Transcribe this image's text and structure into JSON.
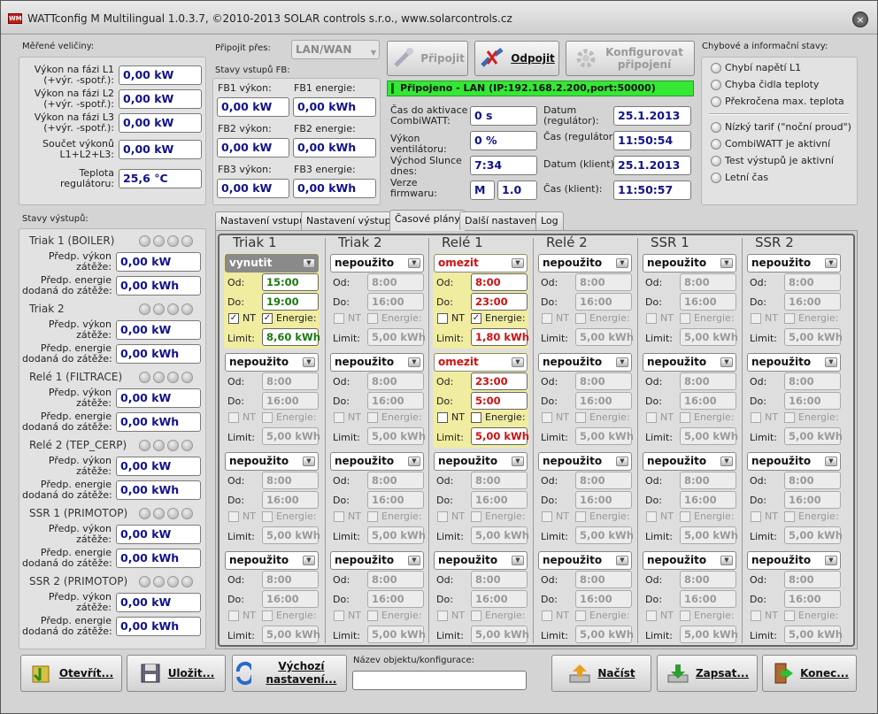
{
  "title": "WATTconfig M  Multilingual 1.0.3.7, ©2010-2013 SOLAR controls s.r.o., www.solarcontrols.cz",
  "logo_text": "WM",
  "close_glyph": "×",
  "measured": {
    "title": "Měřené veličiny:",
    "rows": [
      {
        "label": "Výkon na fázi L1\n(+výr. -spotř.):",
        "value": "0,00 kW"
      },
      {
        "label": "Výkon na fázi L2\n(+výr. -spotř.):",
        "value": "0,00 kW"
      },
      {
        "label": "Výkon na fázi L3\n(+výr. -spotř.):",
        "value": "0,00 kW"
      },
      {
        "label": "Součet výkonů\nL1+L2+L3:",
        "value": "0,00 kW"
      },
      {
        "label": "Teplota\nregulátoru:",
        "value": "25,6 °C"
      }
    ]
  },
  "connect": {
    "via_label": "Připojit přes:",
    "via_value": "LAN/WAN",
    "connect_btn": "Připojit",
    "disconnect_btn": "Odpojit",
    "config_btn": "Konfigurovat připojení",
    "status": "Připojeno - LAN (IP:192.168.2.200,port:50000)"
  },
  "fb": {
    "title": "Stavy vstupů FB:",
    "items": [
      {
        "power_label": "FB1 výkon:",
        "power": "0,00 kW",
        "energy_label": "FB1 energie:",
        "energy": "0,00 kWh"
      },
      {
        "power_label": "FB2 výkon:",
        "power": "0,00 kW",
        "energy_label": "FB2 energie:",
        "energy": "0,00 kWh"
      },
      {
        "power_label": "FB3 výkon:",
        "power": "0,00 kW",
        "energy_label": "FB3 energie:",
        "energy": "0,00 kWh"
      }
    ]
  },
  "info": {
    "activation_label": "Čas do aktivace\nCombiWATT:",
    "activation": "0 s",
    "fan_label": "Výkon ventilátoru:",
    "fan": "0 %",
    "sunrise_label": "Východ Slunce\ndnes:",
    "sunrise": "7:34",
    "fw_label": "Verze\nfirmwaru:",
    "fw_a": "M",
    "fw_b": "1.0",
    "date_reg_label": "Datum\n(regulátor):",
    "date_reg": "25.1.2013",
    "time_reg_label": "Čas (regulátor):",
    "time_reg": "11:50:54",
    "date_cli_label": "Datum (klient):",
    "date_cli": "25.1.2013",
    "time_cli_label": "Čas (klient):",
    "time_cli": "11:50:57"
  },
  "errors": {
    "title": "Chybové a informační stavy:",
    "items": [
      "Chybí napětí L1",
      "Chyba čidla teploty",
      "Překročena max. teplota",
      "Nízký tarif (\"noční proud\")",
      "CombiWATT je aktivní",
      "Test výstupů je aktivní",
      "Letní čas"
    ]
  },
  "outputs": {
    "title": "Stavy výstupů:",
    "power_label": "Předp. výkon\nzátěže:",
    "energy_label": "Předp. energie\ndodaná do zátěže:",
    "items": [
      {
        "name": "Triak 1 (BOILER)",
        "power": "0,00 kW",
        "energy": "0,00 kWh"
      },
      {
        "name": "Triak 2",
        "power": "0,00 kW",
        "energy": "0,00 kWh"
      },
      {
        "name": "Relé 1 (FILTRACE)",
        "power": "0,00 kW",
        "energy": "0,00 kWh"
      },
      {
        "name": "Relé 2 (TEP_CERP)",
        "power": "0,00 kW",
        "energy": "0,00 kWh"
      },
      {
        "name": "SSR 1 (PRIMOTOP)",
        "power": "0,00 kW",
        "energy": "0,00 kWh"
      },
      {
        "name": "SSR 2 (PRIMOTOP)",
        "power": "0,00 kW",
        "energy": "0,00 kWh"
      }
    ]
  },
  "tabs": [
    "Nastavení vstupů",
    "Nastavení výstupů",
    "Časové plány",
    "Další nastavení",
    "Log"
  ],
  "active_tab": 2,
  "schedule": {
    "from_label": "Od:",
    "to_label": "Do:",
    "nt_label": "NT",
    "energy_label": "Energie:",
    "limit_label": "Limit:",
    "columns": [
      {
        "name": "Triak 1",
        "blocks": [
          {
            "mode": "vynutit",
            "style": "gray",
            "active": true,
            "from": "15:00",
            "to": "19:00",
            "nt": true,
            "energy": true,
            "limit": "8,60 kWh",
            "tone": "ok"
          },
          {
            "mode": "nepoužito",
            "from": "8:00",
            "to": "16:00",
            "limit": "5,00 kWh"
          },
          {
            "mode": "nepoužito",
            "from": "8:00",
            "to": "16:00",
            "limit": "5,00 kWh"
          },
          {
            "mode": "nepoužito",
            "from": "8:00",
            "to": "16:00",
            "limit": "5,00 kWh"
          }
        ]
      },
      {
        "name": "Triak 2",
        "blocks": [
          {
            "mode": "nepoužito",
            "from": "8:00",
            "to": "16:00",
            "limit": "5,00 kWh"
          },
          {
            "mode": "nepoužito",
            "from": "8:00",
            "to": "16:00",
            "limit": "5,00 kWh"
          },
          {
            "mode": "nepoužito",
            "from": "8:00",
            "to": "16:00",
            "limit": "5,00 kWh"
          },
          {
            "mode": "nepoužito",
            "from": "8:00",
            "to": "16:00",
            "limit": "5,00 kWh"
          }
        ]
      },
      {
        "name": "Relé 1",
        "blocks": [
          {
            "mode": "omezit",
            "style": "red",
            "active": true,
            "from": "8:00",
            "to": "23:00",
            "nt": false,
            "energy": true,
            "limit": "1,80 kWh",
            "tone": "err"
          },
          {
            "mode": "omezit",
            "style": "red",
            "active": true,
            "from": "23:00",
            "to": "5:00",
            "nt": false,
            "energy": false,
            "limit": "5,00 kWh",
            "tone": "err"
          },
          {
            "mode": "nepoužito",
            "from": "8:00",
            "to": "16:00",
            "limit": "5,00 kWh"
          },
          {
            "mode": "nepoužito",
            "from": "8:00",
            "to": "16:00",
            "limit": "5,00 kWh"
          }
        ]
      },
      {
        "name": "Relé 2",
        "blocks": [
          {
            "mode": "nepoužito",
            "from": "8:00",
            "to": "16:00",
            "limit": "5,00 kWh"
          },
          {
            "mode": "nepoužito",
            "from": "8:00",
            "to": "16:00",
            "limit": "5,00 kWh"
          },
          {
            "mode": "nepoužito",
            "from": "8:00",
            "to": "16:00",
            "limit": "5,00 kWh"
          },
          {
            "mode": "nepoužito",
            "from": "8:00",
            "to": "16:00",
            "limit": "5,00 kWh"
          }
        ]
      },
      {
        "name": "SSR 1",
        "blocks": [
          {
            "mode": "nepoužito",
            "from": "8:00",
            "to": "16:00",
            "limit": "5,00 kWh"
          },
          {
            "mode": "nepoužito",
            "from": "8:00",
            "to": "16:00",
            "limit": "5,00 kWh"
          },
          {
            "mode": "nepoužito",
            "from": "8:00",
            "to": "16:00",
            "limit": "5,00 kWh"
          },
          {
            "mode": "nepoužito",
            "from": "8:00",
            "to": "16:00",
            "limit": "5,00 kWh"
          }
        ]
      },
      {
        "name": "SSR 2",
        "blocks": [
          {
            "mode": "nepoužito",
            "from": "8:00",
            "to": "16:00",
            "limit": "5,00 kWh"
          },
          {
            "mode": "nepoužito",
            "from": "8:00",
            "to": "16:00",
            "limit": "5,00 kWh"
          },
          {
            "mode": "nepoužito",
            "from": "8:00",
            "to": "16:00",
            "limit": "5,00 kWh"
          },
          {
            "mode": "nepoužito",
            "from": "8:00",
            "to": "16:00",
            "limit": "5,00 kWh"
          }
        ]
      }
    ]
  },
  "bottom": {
    "open": "Otevřít...",
    "save": "Uložit...",
    "defaults": "Výchozí nastavení...",
    "object_name_label": "Název objektu/konfigurace:",
    "object_name": "",
    "load": "Načíst",
    "write": "Zapsat...",
    "exit": "Konec..."
  },
  "colors": {
    "status_bg": "#34e834",
    "active_block": "#f0eca0",
    "ok_text": "#1a7a10",
    "err_text": "#d01010"
  }
}
